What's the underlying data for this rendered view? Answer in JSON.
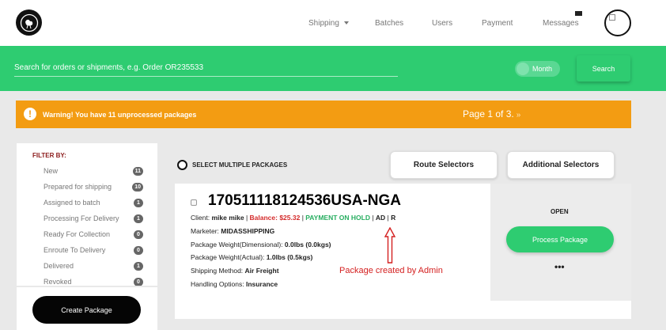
{
  "nav": {
    "items": [
      {
        "label": "Shipping",
        "dropdown": true
      },
      {
        "label": "Batches"
      },
      {
        "label": "Users"
      },
      {
        "label": "Payment"
      },
      {
        "label": "Messages"
      }
    ]
  },
  "search": {
    "placeholder": "Search for orders or shipments, e.g. Order OR235533",
    "toggle_label": "Month",
    "button_label": "Search"
  },
  "warning": {
    "text": "Warning! You have 11 unprocessed packages",
    "page_text": "Page 1 of 3.",
    "next": "»"
  },
  "filter": {
    "title": "FILTER BY:",
    "items": [
      {
        "label": "New",
        "count": "11"
      },
      {
        "label": "Prepared for shipping",
        "count": "10"
      },
      {
        "label": "Assigned to batch",
        "count": "1"
      },
      {
        "label": "Processing For Delivery",
        "count": "1"
      },
      {
        "label": "Ready For Collection",
        "count": "0"
      },
      {
        "label": "Enroute To Delivery",
        "count": "0"
      },
      {
        "label": "Delivered",
        "count": "1"
      },
      {
        "label": "Revoked",
        "count": "0"
      }
    ],
    "create_button": "Create Package"
  },
  "selectors": {
    "select_multiple": "SELECT MULTIPLE PACKAGES",
    "route": "Route Selectors",
    "additional": "Additional Selectors"
  },
  "package": {
    "id": "170511118124536USA-NGA",
    "client_label": "Client:",
    "client_name": "mike mike",
    "balance": "Balance: $25.32",
    "status_hold": "PAYMENT ON HOLD",
    "tag_ad": "AD",
    "tag_r": "R",
    "marketer_label": "Marketer:",
    "marketer": "MIDASSHIPPING",
    "weight_dim_label": "Package Weight(Dimensional):",
    "weight_dim": "0.0lbs (0.0kgs)",
    "weight_act_label": "Package Weight(Actual):",
    "weight_act": "1.0lbs (0.5kgs)",
    "shipping_label": "Shipping Method:",
    "shipping": "Air Freight",
    "handling_label": "Handling Options:",
    "handling": "Insurance",
    "status": "OPEN",
    "process_button": "Process Package",
    "more": "•••"
  },
  "annotation": "Package created by Admin",
  "colors": {
    "brand_green": "#2ecc71",
    "warning_orange": "#f39c12",
    "balance_red": "#d42a2a",
    "hold_green": "#27ae60"
  }
}
